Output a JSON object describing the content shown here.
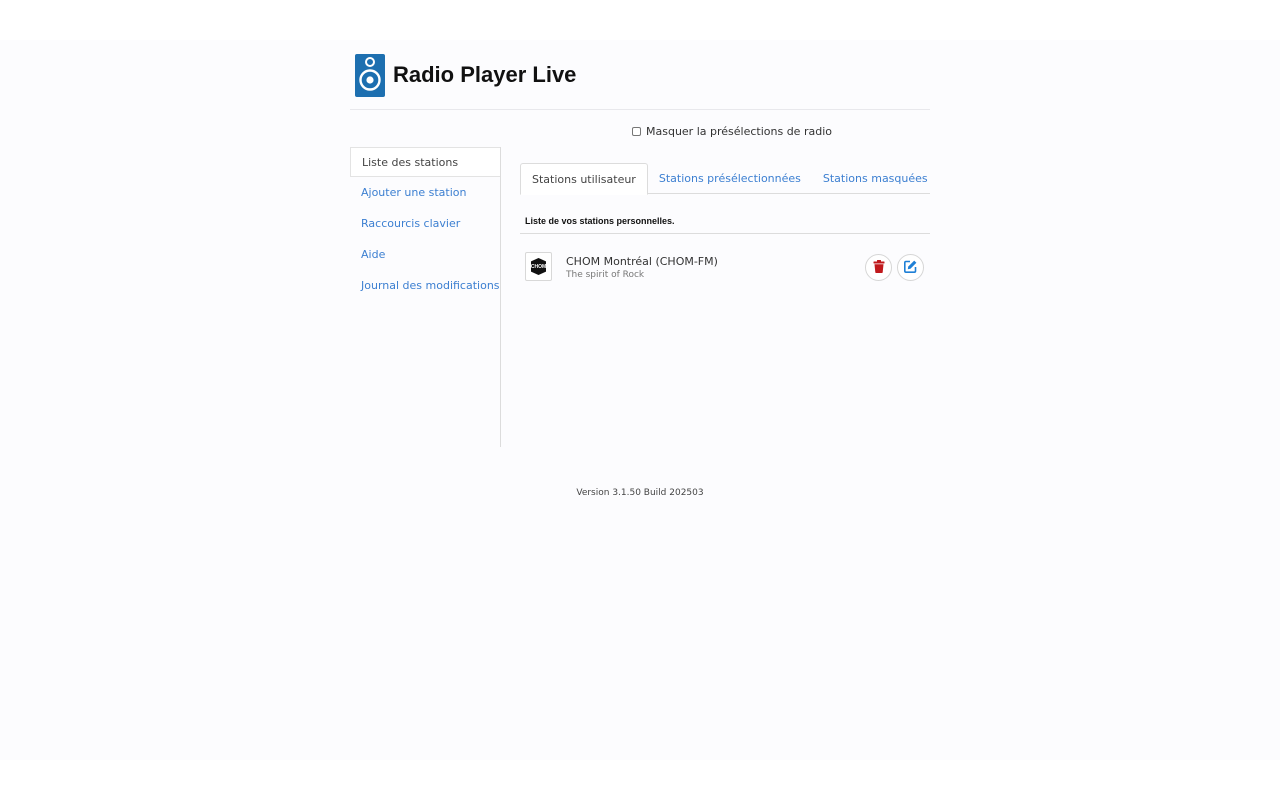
{
  "app": {
    "title": "Radio Player Live"
  },
  "options": {
    "hide_presets_label": "Masquer la présélections de radio",
    "hide_presets_checked": false
  },
  "sidebar": {
    "items": [
      {
        "label": "Liste des stations",
        "active": true
      },
      {
        "label": "Ajouter une station",
        "active": false
      },
      {
        "label": "Raccourcis clavier",
        "active": false
      },
      {
        "label": "Aide",
        "active": false
      },
      {
        "label": "Journal des modifications",
        "active": false
      }
    ]
  },
  "tabs": [
    {
      "label": "Stations utilisateur",
      "active": true
    },
    {
      "label": "Stations présélectionnées",
      "active": false
    },
    {
      "label": "Stations masquées",
      "active": false
    }
  ],
  "list": {
    "caption": "Liste de vos stations personnelles.",
    "stations": [
      {
        "name": "CHOM Montréal (CHOM-FM)",
        "description": "The spirit of Rock",
        "logo_text": "CHOM",
        "delete_icon": "trash-icon",
        "edit_icon": "edit-icon"
      }
    ]
  },
  "footer": {
    "version": "Version 3.1.50 Build 202503"
  },
  "colors": {
    "brand": "#1d6fb0",
    "link": "#3c7fd1",
    "delete": "#c0191c",
    "edit": "#1e7fd6"
  }
}
